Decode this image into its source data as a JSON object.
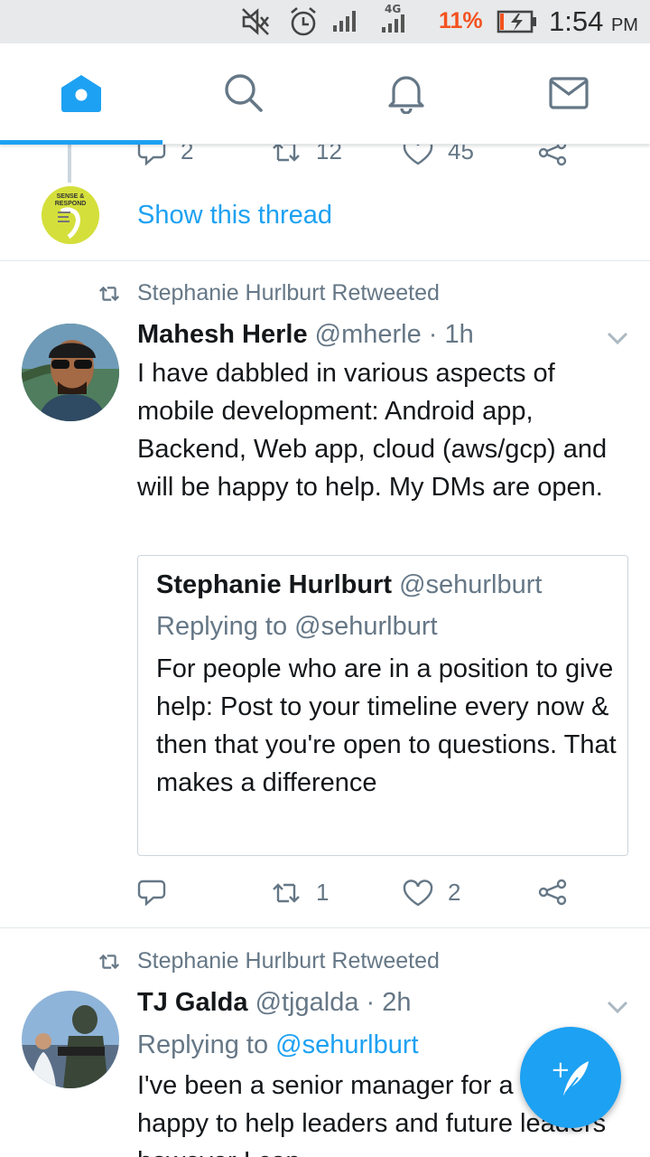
{
  "status_bar": {
    "battery_percent": "11%",
    "time": "1:54",
    "ampm": "PM",
    "network_label": "4G",
    "icons": [
      "mute-icon",
      "alarm-icon",
      "signal-icon",
      "signal-4g-icon",
      "battery-charging-icon"
    ],
    "battery_color": "#f4511e"
  },
  "nav": {
    "tabs": [
      {
        "name": "home",
        "icon": "home-icon",
        "active": true
      },
      {
        "name": "search",
        "icon": "search-icon",
        "active": false
      },
      {
        "name": "notifications",
        "icon": "bell-icon",
        "active": false
      },
      {
        "name": "messages",
        "icon": "mail-icon",
        "active": false
      }
    ],
    "accent": "#1da1f2"
  },
  "prev_tweet": {
    "reply_count": "2",
    "retweet_count": "12",
    "like_count": "45",
    "avatar_text_line1": "SENSE &",
    "avatar_text_line2": "RESPOND",
    "show_thread": "Show this thread"
  },
  "tweet1": {
    "retweeted_by": "Stephanie Hurlburt Retweeted",
    "name": "Mahesh Herle",
    "handle": "@mherle",
    "separator": "·",
    "time": "1h",
    "text": "I have dabbled in various aspects of mobile development: Android app, Backend, Web app, cloud (aws/gcp) and will be happy to help. My DMs are open.",
    "quote": {
      "name": "Stephanie Hurlburt",
      "handle": "@sehurlburt",
      "replying_to": "Replying to @sehurlburt",
      "text": "For people who are in a position to give help: Post to your timeline every now & then that you're open to questions. That makes a difference"
    },
    "reply_count": "",
    "retweet_count": "1",
    "like_count": "2"
  },
  "tweet2": {
    "retweeted_by": "Stephanie Hurlburt Retweeted",
    "name": "TJ Galda",
    "handle": "@tjgalda",
    "separator": "·",
    "time": "2h",
    "replying_label": "Replying to",
    "replying_mention": "@sehurlburt",
    "text": "I've been a senior manager for a while, happy to help leaders and future leaders however I can."
  },
  "fab": {
    "icon": "compose-icon",
    "symbol": "+"
  }
}
